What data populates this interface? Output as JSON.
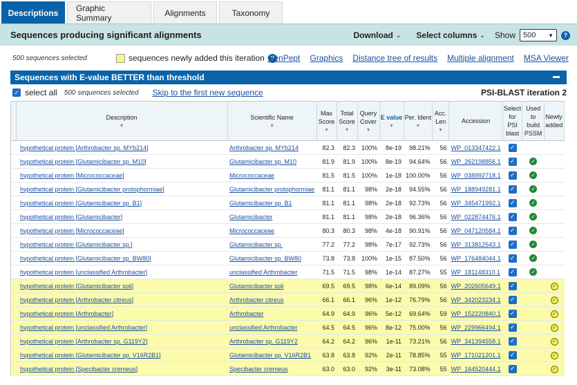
{
  "tabs": [
    "Descriptions",
    "Graphic Summary",
    "Alignments",
    "Taxonomy"
  ],
  "header": {
    "title": "Sequences producing significant alignments",
    "download": "Download",
    "select_columns": "Select columns",
    "show_label": "Show",
    "show_value": "500"
  },
  "toolbar": {
    "selected_count": "500 sequences selected",
    "new_iteration_label": "sequences newly added this iteration",
    "links": [
      "GenPept",
      "Graphics",
      "Distance tree of results",
      "Multiple alignment",
      "MSA Viewer"
    ]
  },
  "banner": {
    "title": "Sequences with E-value BETTER than threshold"
  },
  "select_row": {
    "select_all": "select all",
    "selected_count": "500 sequences selected",
    "skip_link": "Skip to the first new sequence",
    "iteration": "PSI-BLAST iteration 2"
  },
  "columns": {
    "description": "Description",
    "scientific_name": "Scientific Name",
    "max_score": "Max Score",
    "total_score": "Total Score",
    "query_cover": "Query Cover",
    "e_value": "E value",
    "per_ident": "Per. Ident",
    "acc_len": "Acc. Len",
    "accession": "Accession",
    "select_psi": "Select for PSI blast",
    "used_pssm": "Used to build PSSM",
    "newly_added": "Newly added"
  },
  "rows": [
    {
      "description": "hypothetical protein [Arthrobacter sp. MYb214]",
      "scientific_name": "Arthrobacter sp. MYb214",
      "max_score": "82.3",
      "total_score": "82.3",
      "query_cover": "100%",
      "e_value": "8e-19",
      "per_ident": "98.21%",
      "acc_len": "56",
      "accession": "WP_013347422.1",
      "pssm": false,
      "new": false
    },
    {
      "description": "hypothetical protein [Glutamicibacter sp. M10]",
      "scientific_name": "Glutamicibacter sp. M10",
      "max_score": "81.9",
      "total_score": "81.9",
      "query_cover": "100%",
      "e_value": "8e-19",
      "per_ident": "94.64%",
      "acc_len": "56",
      "accession": "WP_262198856.1",
      "pssm": true,
      "new": false
    },
    {
      "description": "hypothetical protein [Micrococcaceae]",
      "scientific_name": "Micrococcaceae",
      "max_score": "81.5",
      "total_score": "81.5",
      "query_cover": "100%",
      "e_value": "1e-18",
      "per_ident": "100.00%",
      "acc_len": "56",
      "accession": "WP_038992718.1",
      "pssm": true,
      "new": false
    },
    {
      "description": "hypothetical protein [Glutamicibacter protophormiae]",
      "scientific_name": "Glutamicibacter protophormiae",
      "max_score": "81.1",
      "total_score": "81.1",
      "query_cover": "98%",
      "e_value": "2e-18",
      "per_ident": "94.55%",
      "acc_len": "56",
      "accession": "WP_188949281.1",
      "pssm": true,
      "new": false
    },
    {
      "description": "hypothetical protein [Glutamicibacter sp. B1]",
      "scientific_name": "Glutamicibacter sp. B1",
      "max_score": "81.1",
      "total_score": "81.1",
      "query_cover": "98%",
      "e_value": "2e-18",
      "per_ident": "92.73%",
      "acc_len": "56",
      "accession": "WP_345471992.1",
      "pssm": true,
      "new": false
    },
    {
      "description": "hypothetical protein [Glutamicibacter]",
      "scientific_name": "Glutamicibacter",
      "max_score": "81.1",
      "total_score": "81.1",
      "query_cover": "98%",
      "e_value": "2e-18",
      "per_ident": "96.36%",
      "acc_len": "56",
      "accession": "WP_022874476.1",
      "pssm": true,
      "new": false
    },
    {
      "description": "hypothetical protein [Micrococcaceae]",
      "scientific_name": "Micrococcaceae",
      "max_score": "80.3",
      "total_score": "80.3",
      "query_cover": "98%",
      "e_value": "4e-18",
      "per_ident": "90.91%",
      "acc_len": "56",
      "accession": "WP_047120584.1",
      "pssm": true,
      "new": false
    },
    {
      "description": "hypothetical protein [Glutamicibacter sp.]",
      "scientific_name": "Glutamicibacter sp.",
      "max_score": "77.2",
      "total_score": "77.2",
      "query_cover": "98%",
      "e_value": "7e-17",
      "per_ident": "92.73%",
      "acc_len": "56",
      "accession": "WP_313812543.1",
      "pssm": true,
      "new": false
    },
    {
      "description": "hypothetical protein [Glutamicibacter sp. BW80]",
      "scientific_name": "Glutamicibacter sp. BW80",
      "max_score": "73.8",
      "total_score": "73.8",
      "query_cover": "100%",
      "e_value": "1e-15",
      "per_ident": "87.50%",
      "acc_len": "56",
      "accession": "WP_176484044.1",
      "pssm": true,
      "new": false
    },
    {
      "description": "hypothetical protein [unclassified Arthrobacter]",
      "scientific_name": "unclassified Arthrobacter",
      "max_score": "71.5",
      "total_score": "71.5",
      "query_cover": "98%",
      "e_value": "1e-14",
      "per_ident": "87.27%",
      "acc_len": "55",
      "accession": "WP_181148310.1",
      "pssm": true,
      "new": false
    },
    {
      "description": "hypothetical protein [Glutamicibacter soli]",
      "scientific_name": "Glutamicibacter soli",
      "max_score": "69.5",
      "total_score": "69.5",
      "query_cover": "98%",
      "e_value": "6e-14",
      "per_ident": "89.09%",
      "acc_len": "56",
      "accession": "WP_202605649.1",
      "pssm": false,
      "new": true
    },
    {
      "description": "hypothetical protein [Arthrobacter citreus]",
      "scientific_name": "Arthrobacter citreus",
      "max_score": "66.1",
      "total_score": "66.1",
      "query_cover": "96%",
      "e_value": "1e-12",
      "per_ident": "76.79%",
      "acc_len": "56",
      "accession": "WP_342023234.1",
      "pssm": false,
      "new": true
    },
    {
      "description": "hypothetical protein [Arthrobacter]",
      "scientific_name": "Arthrobacter",
      "max_score": "64.9",
      "total_score": "64.9",
      "query_cover": "96%",
      "e_value": "5e-12",
      "per_ident": "69.64%",
      "acc_len": "59",
      "accession": "WP_152220840.1",
      "pssm": false,
      "new": true
    },
    {
      "description": "hypothetical protein [unclassified Arthrobacter]",
      "scientific_name": "unclassified Arthrobacter",
      "max_score": "64.5",
      "total_score": "64.5",
      "query_cover": "96%",
      "e_value": "8e-12",
      "per_ident": "75.00%",
      "acc_len": "56",
      "accession": "WP_229966494.1",
      "pssm": false,
      "new": true
    },
    {
      "description": "hypothetical protein [Arthrobacter sp. G119Y2]",
      "scientific_name": "Arthrobacter sp. G119Y2",
      "max_score": "64.2",
      "total_score": "64.2",
      "query_cover": "96%",
      "e_value": "1e-11",
      "per_ident": "73.21%",
      "acc_len": "56",
      "accession": "WP_341394558.1",
      "pssm": false,
      "new": true
    },
    {
      "description": "hypothetical protein [Glutamicibacter sp. V16R2B1]",
      "scientific_name": "Glutamicibacter sp. V16R2B1",
      "max_score": "63.8",
      "total_score": "63.8",
      "query_cover": "92%",
      "e_value": "2e-11",
      "per_ident": "78.85%",
      "acc_len": "55",
      "accession": "WP_171021201.1",
      "pssm": false,
      "new": true
    },
    {
      "description": "hypothetical protein [Specibacter cremeus]",
      "scientific_name": "Specibacter cremeus",
      "max_score": "63.0",
      "total_score": "63.0",
      "query_cover": "92%",
      "e_value": "3e-11",
      "per_ident": "73.08%",
      "acc_len": "55",
      "accession": "WP_164520444.1",
      "pssm": false,
      "new": true
    }
  ],
  "colors": {
    "tab_active": "#0a63a8",
    "header_bg": "#c7e3e3",
    "banner_bg": "#0a63a8",
    "new_row_bg": "#fbfbab",
    "checkbox_blue": "#1d6ec7",
    "pssm_green": "#218838"
  }
}
